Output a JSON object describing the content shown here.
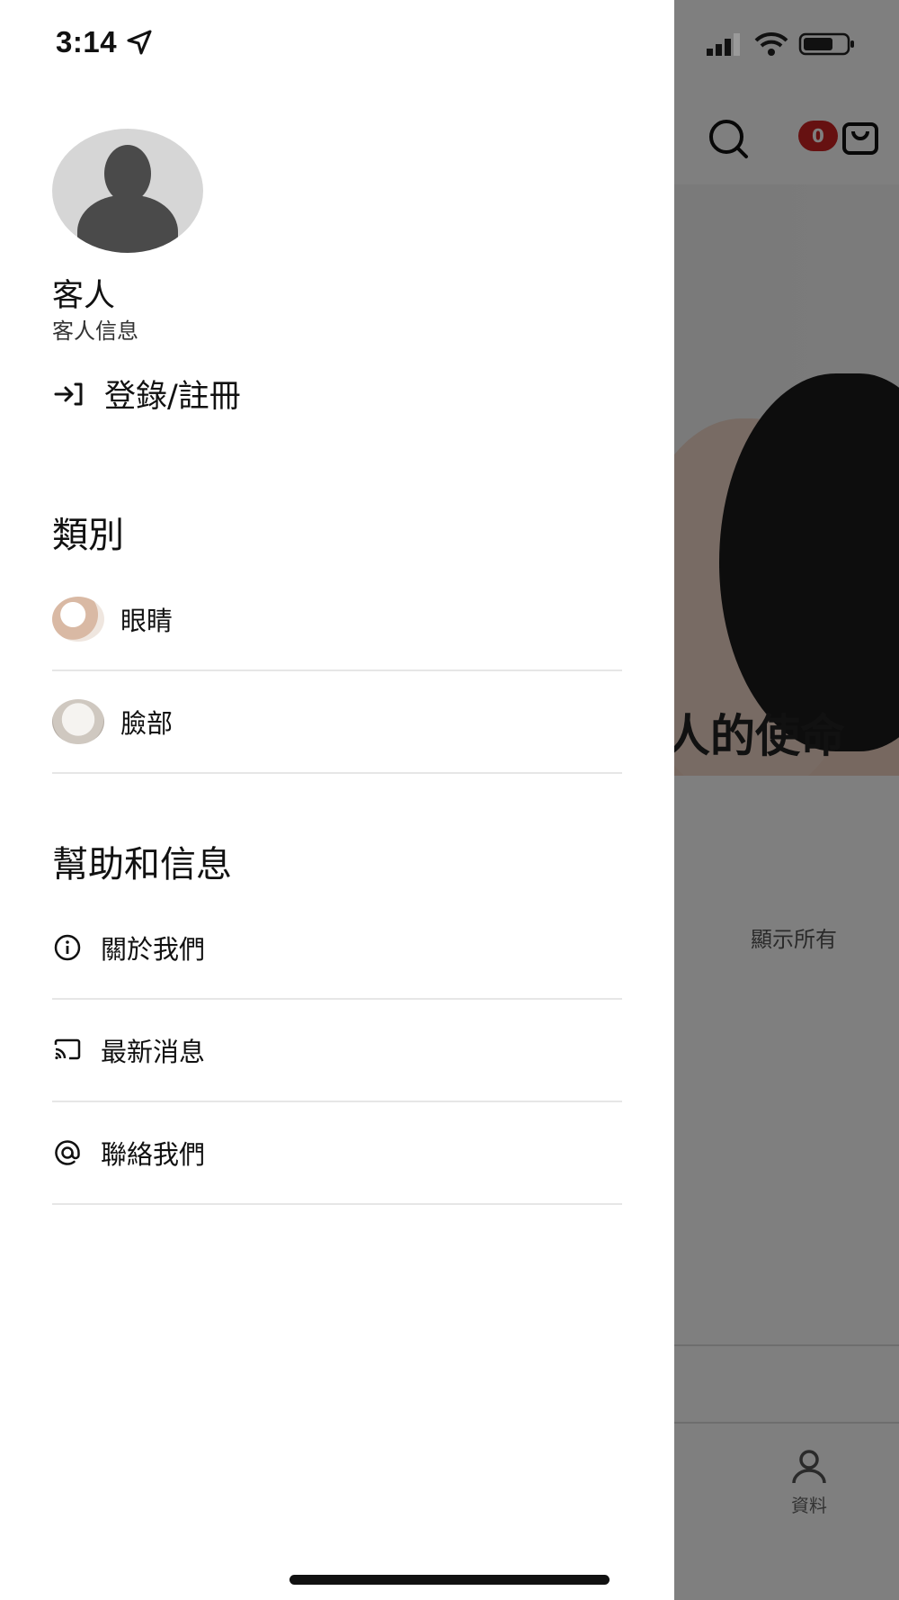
{
  "status_bar": {
    "time": "3:14"
  },
  "background": {
    "cart_count": "0",
    "hero_text": "人的使命",
    "show_all": "顯示所有",
    "profile_tab": "資料"
  },
  "drawer": {
    "user": {
      "name": "客人",
      "subtitle": "客人信息"
    },
    "login_label": "登錄/註冊",
    "categories_title": "類別",
    "categories": [
      {
        "label": "眼睛",
        "thumb_color": "#d9b9a4"
      },
      {
        "label": "臉部",
        "thumb_color": "#cfc8c0"
      }
    ],
    "help_title": "幫助和信息",
    "help_items": [
      {
        "label": "關於我們",
        "icon": "info-icon"
      },
      {
        "label": "最新消息",
        "icon": "cast-icon"
      },
      {
        "label": "聯絡我們",
        "icon": "at-icon"
      }
    ]
  },
  "colors": {
    "badge": "#cc2222",
    "overlay": "rgba(0,0,0,0.5)"
  }
}
